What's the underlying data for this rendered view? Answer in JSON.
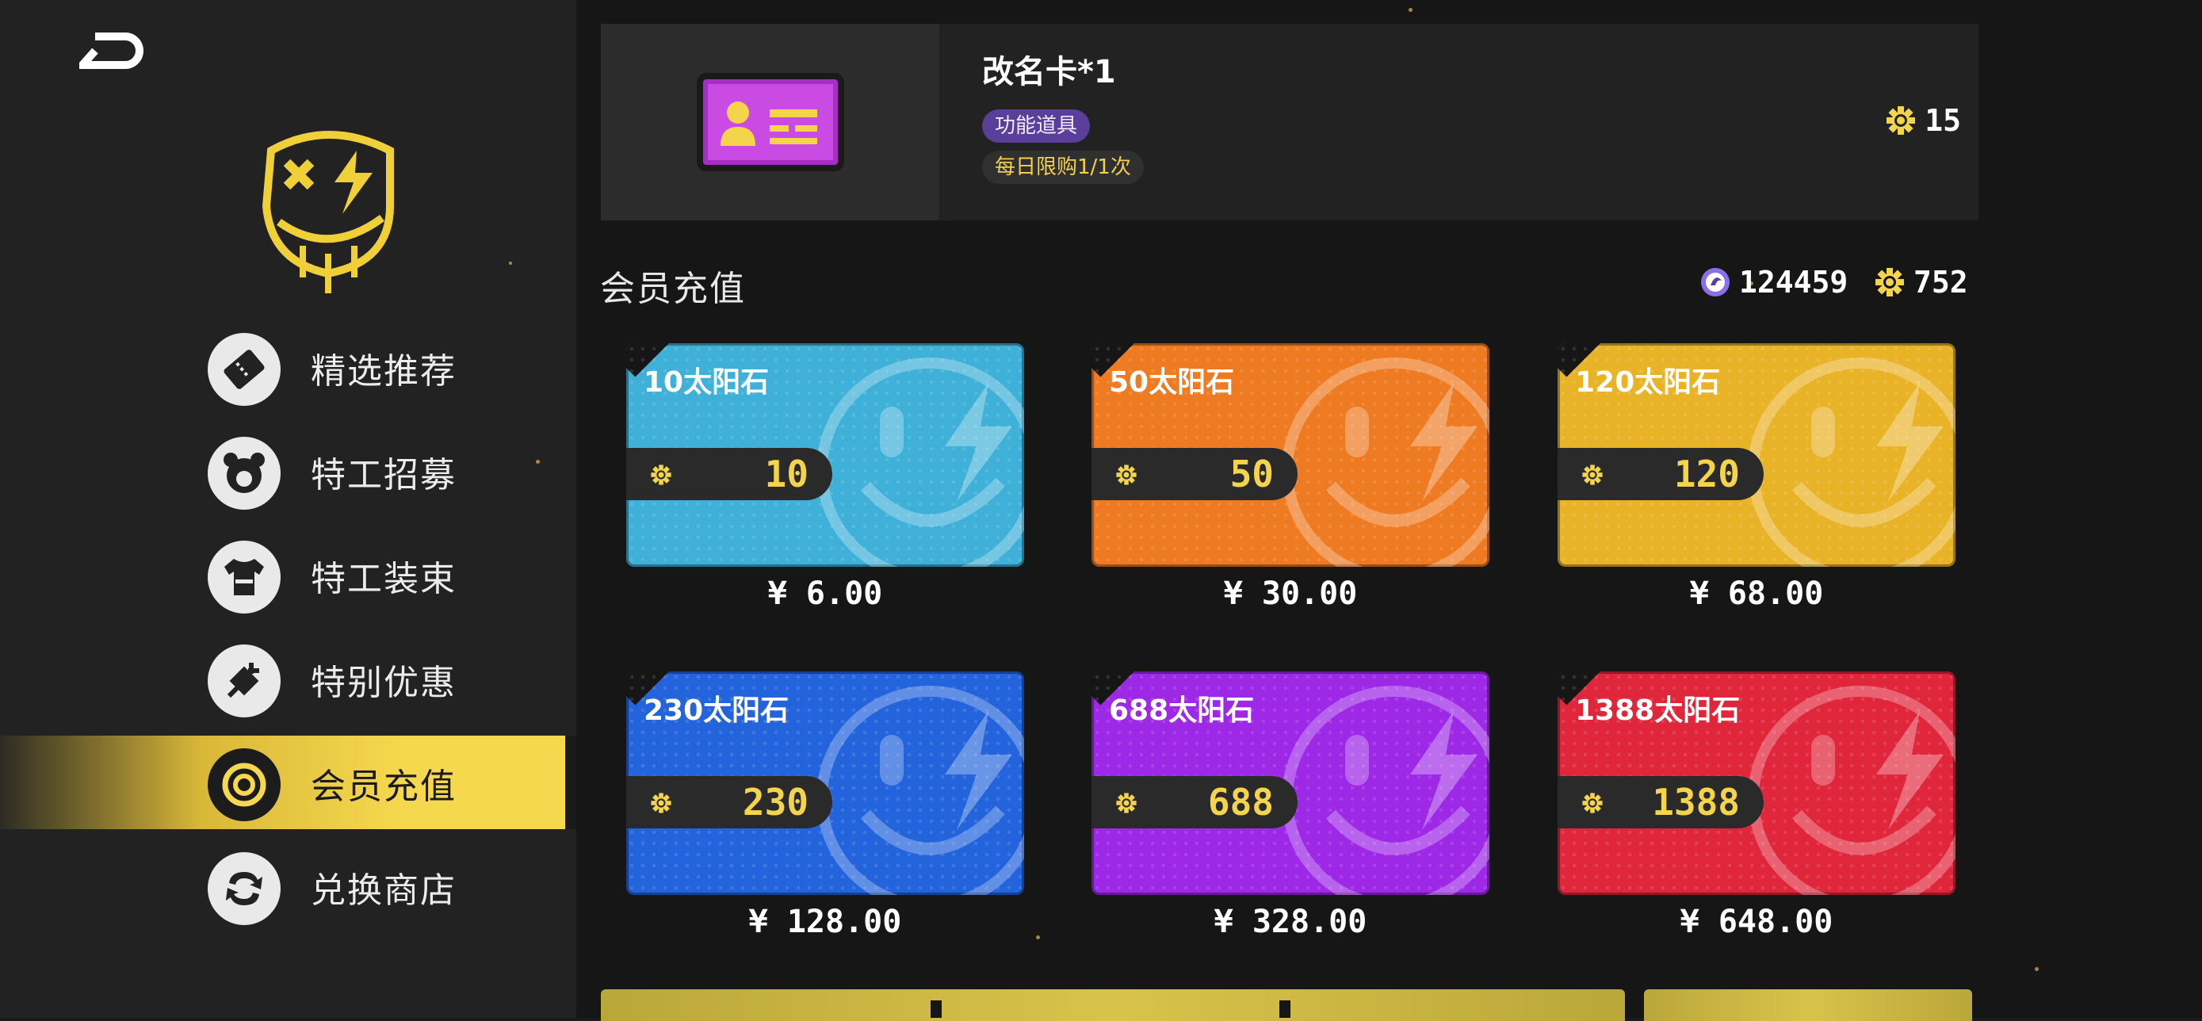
{
  "sidebar": {
    "items": [
      {
        "label": "精选推荐",
        "icon": "ticket-icon",
        "active": false
      },
      {
        "label": "特工招募",
        "icon": "bear-face-icon",
        "active": false
      },
      {
        "label": "特工装束",
        "icon": "tshirt-icon",
        "active": false
      },
      {
        "label": "特别优惠",
        "icon": "plug-icon",
        "active": false
      },
      {
        "label": "会员充值",
        "icon": "target-icon",
        "active": true
      },
      {
        "label": "兑换商店",
        "icon": "exchange-icon",
        "active": false
      }
    ]
  },
  "featured": {
    "title": "改名卡*1",
    "tag_type": "功能道具",
    "tag_limit": "每日限购1/1次",
    "price": "15",
    "price_icon": "sun-stone-icon"
  },
  "section": {
    "title": "会员充值",
    "currency_a": "124459",
    "currency_a_icon": "coin-icon",
    "currency_b": "752",
    "currency_b_icon": "sun-stone-icon"
  },
  "products": [
    {
      "name": "10太阳石",
      "amount": "10",
      "price": "¥ 6.00",
      "color": "#3fb0d8"
    },
    {
      "name": "50太阳石",
      "amount": "50",
      "price": "¥ 30.00",
      "color": "#ee7a22"
    },
    {
      "name": "120太阳石",
      "amount": "120",
      "price": "¥ 68.00",
      "color": "#e9b328"
    },
    {
      "name": "230太阳石",
      "amount": "230",
      "price": "¥ 128.00",
      "color": "#2364dc"
    },
    {
      "name": "688太阳石",
      "amount": "688",
      "price": "¥ 328.00",
      "color": "#9d28e6"
    },
    {
      "name": "1388太阳石",
      "amount": "1388",
      "price": "¥ 648.00",
      "color": "#e0263b"
    }
  ],
  "colors": {
    "accent": "#f6d84e",
    "sun": "#f3d44a",
    "tag_purple": "#5a3f9a"
  }
}
